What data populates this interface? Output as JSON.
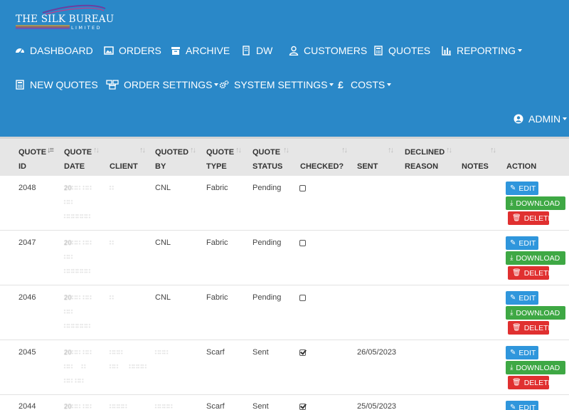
{
  "brand": {
    "name": "THE SILK BUREAU",
    "sub": "LIMITED"
  },
  "nav": {
    "dashboard": "DASHBOARD",
    "orders": "ORDERS",
    "archive": "ARCHIVE",
    "dw": "DW",
    "customers": "CUSTOMERS",
    "quotes": "QUOTES",
    "reporting": "REPORTING",
    "new_quotes": "NEW QUOTES",
    "order_settings": "ORDER SETTINGS",
    "system_settings": "SYSTEM SETTINGS",
    "costs_symbol": "£",
    "costs": "COSTS",
    "admin": "ADMIN"
  },
  "columns": {
    "quote_id_1": "QUOTE",
    "quote_id_2": "ID",
    "quote_date_1": "QUOTE",
    "quote_date_2": "DATE",
    "client": "CLIENT",
    "quoted_by_1": "QUOTED",
    "quoted_by_2": "BY",
    "quote_type_1": "QUOTE",
    "quote_type_2": "TYPE",
    "quote_status_1": "QUOTE",
    "quote_status_2": "STATUS",
    "checked": "CHECKED?",
    "sent": "SENT",
    "declined_1": "DECLINED",
    "declined_2": "REASON",
    "notes": "NOTES",
    "action": "ACTION"
  },
  "actions": {
    "edit": "EDIT",
    "download": "DOWNLOAD",
    "delete": "DELETE"
  },
  "rows": [
    {
      "id": "2048",
      "quoted_by": "CNL",
      "type": "Fabric",
      "status": "Pending",
      "checked": false,
      "sent": ""
    },
    {
      "id": "2047",
      "quoted_by": "CNL",
      "type": "Fabric",
      "status": "Pending",
      "checked": false,
      "sent": ""
    },
    {
      "id": "2046",
      "quoted_by": "CNL",
      "type": "Fabric",
      "status": "Pending",
      "checked": false,
      "sent": ""
    },
    {
      "id": "2045",
      "quoted_by": "",
      "type": "Scarf",
      "status": "Sent",
      "checked": true,
      "sent": "26/05/2023"
    },
    {
      "id": "2044",
      "quoted_by": "",
      "type": "Scarf",
      "status": "Sent",
      "checked": true,
      "sent": "25/05/2023"
    }
  ],
  "colors": {
    "header": "#2a88c8",
    "edit": "#2f96dc",
    "download": "#3ea844",
    "delete": "#e03030"
  }
}
